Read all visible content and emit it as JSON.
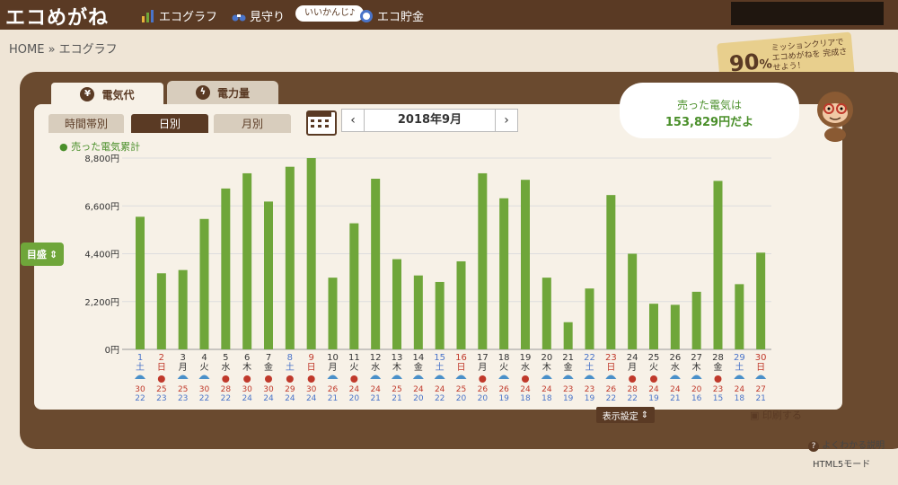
{
  "app": {
    "logo": "エコめがね"
  },
  "nav": [
    {
      "label": "エコグラフ",
      "icon": "bar-chart-icon"
    },
    {
      "label": "見守り",
      "icon": "binoculars-icon"
    },
    {
      "label": "エコ貯金",
      "icon": "coin-icon"
    }
  ],
  "badge": "いいかんじ♪",
  "breadcrumb": "HOME » エコグラフ",
  "tabs": {
    "main": [
      "電気代",
      "電力量"
    ],
    "sub": [
      "時間帯別",
      "日別",
      "月別"
    ]
  },
  "month": "2018年9月",
  "bubble": {
    "line1": "売った電気は",
    "line2": "153,829円だよ"
  },
  "mission": {
    "percent": "90",
    "percent_unit": "%",
    "message": "ミッションクリアで エコめがねを 完成させよう！"
  },
  "scale_label": "目盛",
  "display_settings": "表示設定",
  "print": "印刷する",
  "help": "よくわかる説明",
  "html5": "HTML5モード",
  "colors": {
    "bar": "#6fa63a",
    "brown": "#5a3a24",
    "saturday": "#4a74c9",
    "sunday": "#c0392b"
  },
  "chart_data": {
    "type": "bar",
    "series_label": "売った電気累計",
    "ylim": [
      0,
      8800
    ],
    "yticks": [
      "0円",
      "2,200円",
      "4,400円",
      "6,600円",
      "8,800円"
    ],
    "categories": [
      "1",
      "2",
      "3",
      "4",
      "5",
      "6",
      "7",
      "8",
      "9",
      "10",
      "11",
      "12",
      "13",
      "14",
      "15",
      "16",
      "17",
      "18",
      "19",
      "20",
      "21",
      "22",
      "23",
      "24",
      "25",
      "26",
      "27",
      "28",
      "29",
      "30"
    ],
    "weekdays": [
      "土",
      "日",
      "月",
      "火",
      "水",
      "木",
      "金",
      "土",
      "日",
      "月",
      "火",
      "水",
      "木",
      "金",
      "土",
      "日",
      "月",
      "火",
      "水",
      "木",
      "金",
      "土",
      "日",
      "月",
      "火",
      "水",
      "木",
      "金",
      "土",
      "日"
    ],
    "values": [
      6100,
      3500,
      3650,
      6000,
      7400,
      8100,
      6800,
      8400,
      8800,
      3300,
      5800,
      7850,
      4150,
      3400,
      3100,
      4050,
      8100,
      6950,
      7800,
      3300,
      1250,
      2800,
      7100,
      4400,
      2100,
      2050,
      2650,
      7750,
      3000,
      4450
    ],
    "weather": [
      "umbrella",
      "sun",
      "umbrella",
      "umbrella",
      "sun",
      "sun",
      "sun",
      "sun",
      "sun",
      "umbrella",
      "sun",
      "umbrella",
      "umbrella",
      "umbrella",
      "umbrella",
      "umbrella",
      "sun",
      "umbrella",
      "sun",
      "umbrella",
      "umbrella",
      "umbrella",
      "umbrella",
      "sun",
      "sun",
      "umbrella",
      "umbrella",
      "sun",
      "umbrella",
      "umbrella"
    ],
    "high": [
      "30",
      "25",
      "25",
      "30",
      "28",
      "30",
      "30",
      "29",
      "30",
      "26",
      "24",
      "24",
      "25",
      "24",
      "24",
      "25",
      "26",
      "26",
      "24",
      "24",
      "23",
      "23",
      "26",
      "28",
      "24",
      "24",
      "20",
      "23",
      "24",
      "27"
    ],
    "low": [
      "22",
      "23",
      "23",
      "22",
      "22",
      "24",
      "24",
      "24",
      "24",
      "21",
      "20",
      "21",
      "21",
      "20",
      "22",
      "20",
      "20",
      "19",
      "18",
      "18",
      "19",
      "19",
      "22",
      "22",
      "19",
      "21",
      "16",
      "15",
      "18",
      "21"
    ]
  }
}
